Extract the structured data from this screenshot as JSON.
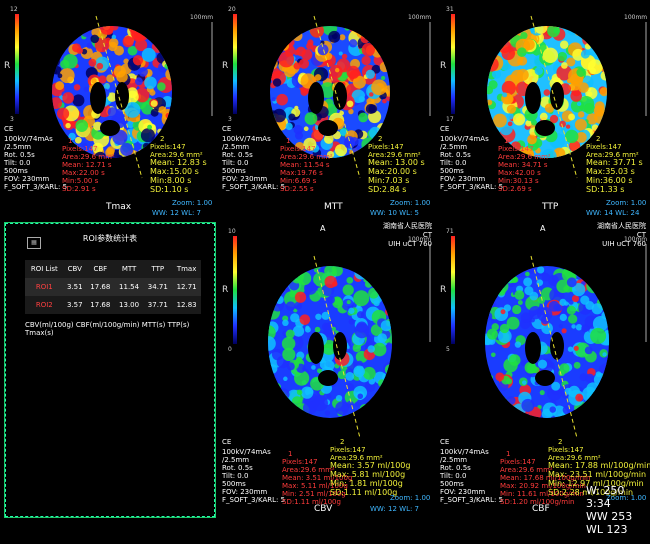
{
  "panes": [
    {
      "id": "tmax",
      "cb_top": "12",
      "cb_bottom": "3",
      "scale": "100mm",
      "map_label": "Tmax",
      "left": [
        "CE",
        "100kV/74mAs",
        "/2.5mm",
        "Rot. 0.5s",
        "Tilt: 0.0",
        "500ms",
        "FOV: 230mm",
        "F_SOFT_3/KARL: 5"
      ],
      "roi1": {
        "num": "1",
        "pixels": "Pixels:147",
        "area": "Area:29.6 mm²",
        "mean": "Mean: 12.71 s",
        "max": "Max:22.00 s",
        "min": "Min:5.00 s",
        "sd": "SD:2.91 s"
      },
      "roi2": {
        "num": "2",
        "pixels": "Pixels:147",
        "area": "Area:29.6 mm²",
        "mean": "Mean: 12.83 s",
        "max": "Max:15.00 s",
        "min": "Min:8.00 s",
        "sd": "SD:1.10 s"
      },
      "zoom": "Zoom: 1.00",
      "ww": "WW: 12",
      "wl": "WL: 7",
      "seg": "1",
      "seg2": "2"
    },
    {
      "id": "mtt",
      "cb_top": "20",
      "cb_bottom": "3",
      "scale": "100mm",
      "map_label": "MTT",
      "left": [
        "CE",
        "100kV/74mAs",
        "/2.5mm",
        "Rot. 0.5s",
        "Tilt: 0.0",
        "500ms",
        "FOV: 230mm",
        "F_SOFT_3/KARL: 5"
      ],
      "roi1": {
        "num": "1",
        "pixels": "Pixels:147",
        "area": "Area:29.6 mm²",
        "mean": "Mean: 11.54 s",
        "max": "Max:19.76 s",
        "min": "Min:6.69 s",
        "sd": "SD:2.55 s"
      },
      "roi2": {
        "num": "2",
        "pixels": "Pixels:147",
        "area": "Area:29.6 mm²",
        "mean": "Mean: 13.00 s",
        "max": "Max:20.00 s",
        "min": "Min:7.03 s",
        "sd": "SD:2.84 s"
      },
      "zoom": "Zoom: 1.00",
      "ww": "WW: 10",
      "wl": "WL: 5",
      "seg": "1",
      "seg2": "2"
    },
    {
      "id": "ttp",
      "cb_top": "31",
      "cb_bottom": "17",
      "scale": "100mm",
      "map_label": "TTP",
      "left": [
        "CE",
        "100kV/74mAs",
        "/2.5mm",
        "Rot. 0.5s",
        "Tilt: 0.0",
        "500ms",
        "FOV: 230mm",
        "F_SOFT_3/KARL: 5"
      ],
      "roi1": {
        "num": "1",
        "pixels": "Pixels:147",
        "area": "Area:29.6 mm²",
        "mean": "Mean: 34.71 s",
        "max": "Max:42.00 s",
        "min": "Min:30.13 s",
        "sd": "SD:2.69 s"
      },
      "roi2": {
        "num": "2",
        "pixels": "Pixels:147",
        "area": "Area:29.6 mm²",
        "mean": "Mean: 37.71 s",
        "max": "Max:35.03 s",
        "min": "Min:36.00 s",
        "sd": "SD:1.33 s"
      },
      "zoom": "Zoom: 1.00",
      "ww": "WW: 14",
      "wl": "WL: 24",
      "seg": "1",
      "seg2": "2"
    },
    {
      "id": "cbv",
      "cb_top": "10",
      "cb_bottom": "0",
      "scale": "100mm",
      "map_label": "CBV",
      "left": [
        "CE",
        "100kV/74mAs",
        "/2.5mm",
        "Rot. 0.5s",
        "Tilt: 0.0",
        "500ms",
        "FOV: 230mm",
        "F_SOFT_3/KARL: 5"
      ],
      "roi1": {
        "num": "1",
        "pixels": "Pixels:147",
        "area": "Area:29.6 mm²",
        "mean": "Mean: 3.51 ml/100g",
        "max": "Max: 5.11 ml/100g",
        "min": "Min: 2.51 ml/100g",
        "sd": "SD:1.11 ml/100g"
      },
      "roi2": {
        "num": "2",
        "pixels": "Pixels:147",
        "area": "Area:29.6 mm²",
        "mean": "Mean: 3.57 ml/100g",
        "max": "Max: 5.81 ml/100g",
        "min": "Min: 1.81 ml/100g",
        "sd": "SD:1.11 ml/100g"
      },
      "zoom": "Zoom: 1.00",
      "ww": "WW: 12",
      "wl": "WL: 7",
      "seg": "1",
      "seg2": "2"
    },
    {
      "id": "cbf",
      "cb_top": "71",
      "cb_bottom": "5",
      "scale": "100mm",
      "map_label": "CBF",
      "left": [
        "CE",
        "100kV/74mAs",
        "/2.5mm",
        "Rot. 0.5s",
        "Tilt: 0.0",
        "500ms",
        "FOV: 230mm",
        "F_SOFT_3/KARL: 5"
      ],
      "roi1": {
        "num": "1",
        "pixels": "Pixels:147",
        "area": "Area:29.6 mm²",
        "mean": "Mean: 17.68 ml/100g/min",
        "max": "Max: 20.92 ml/100g/min",
        "min": "Min: 11.61 ml/100g/min",
        "sd": "SD:1.20 ml/100g/min"
      },
      "roi2": {
        "num": "2",
        "pixels": "Pixels:147",
        "area": "Area:29.6 mm²",
        "mean": "Mean: 17.88 ml/100g/min",
        "max": "Max: 23.51 ml/100g/min",
        "min": "Min: 12.97 ml/100g/min",
        "sd": "SD:2.28 ml/100g/min"
      },
      "zoom": "Zoom: 1.00",
      "ww": "",
      "wl": "",
      "seg": "1",
      "seg2": "2"
    }
  ],
  "hospital": {
    "name": "湖南省人民医院",
    "ct": "CT",
    "model": "UIH uCT 760",
    "orient": "A"
  },
  "roi_table": {
    "title": "ROI参数统计表",
    "headers": [
      "ROI List",
      "CBV",
      "CBF",
      "MTT",
      "TTP",
      "Tmax"
    ],
    "rows": [
      {
        "name": "ROI1",
        "values": [
          "3.51",
          "17.68",
          "11.54",
          "34.71",
          "12.71"
        ]
      },
      {
        "name": "ROI2",
        "values": [
          "3.57",
          "17.68",
          "13.00",
          "37.71",
          "12.83"
        ]
      }
    ],
    "units": "CBV(ml/100g) CBF(ml/100g/min) MTT(s) TTP(s) Tmax(s)"
  },
  "corner": {
    "lines": [
      "W: 250",
      "3:34",
      "WW 253",
      "WL 123"
    ]
  },
  "cb_letter": "R"
}
